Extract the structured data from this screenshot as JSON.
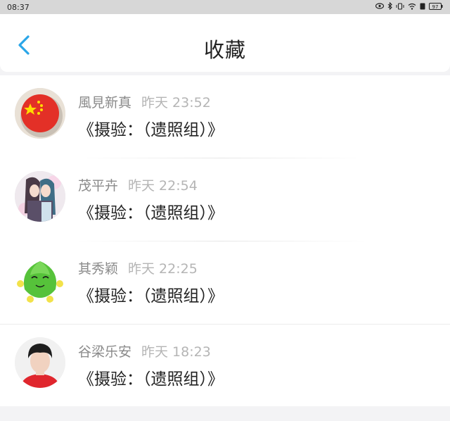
{
  "status_bar": {
    "time": "08:37",
    "icons": [
      "eye-icon",
      "bluetooth-icon",
      "vibrate-icon",
      "wifi-icon",
      "sim-icon",
      "battery-icon"
    ],
    "battery": "97"
  },
  "header": {
    "title": "收藏",
    "back_icon": "chevron-left-icon",
    "accent": "#2aa6e8"
  },
  "items": [
    {
      "name": "風見新真",
      "time": "昨天 23:52",
      "message": "《摄验：（遗照组）》",
      "avatar": "flag-avatar"
    },
    {
      "name": "茂平卉",
      "time": "昨天 22:54",
      "message": "《摄验：（遗照组）》",
      "avatar": "anime-couple-avatar"
    },
    {
      "name": "其秀颖",
      "time": "昨天 22:25",
      "message": "《摄验：（遗照组）》",
      "avatar": "green-mascot-avatar"
    },
    {
      "name": "谷梁乐安",
      "time": "昨天 18:23",
      "message": "《摄验：（遗照组）》",
      "avatar": "boy-portrait-avatar"
    }
  ]
}
